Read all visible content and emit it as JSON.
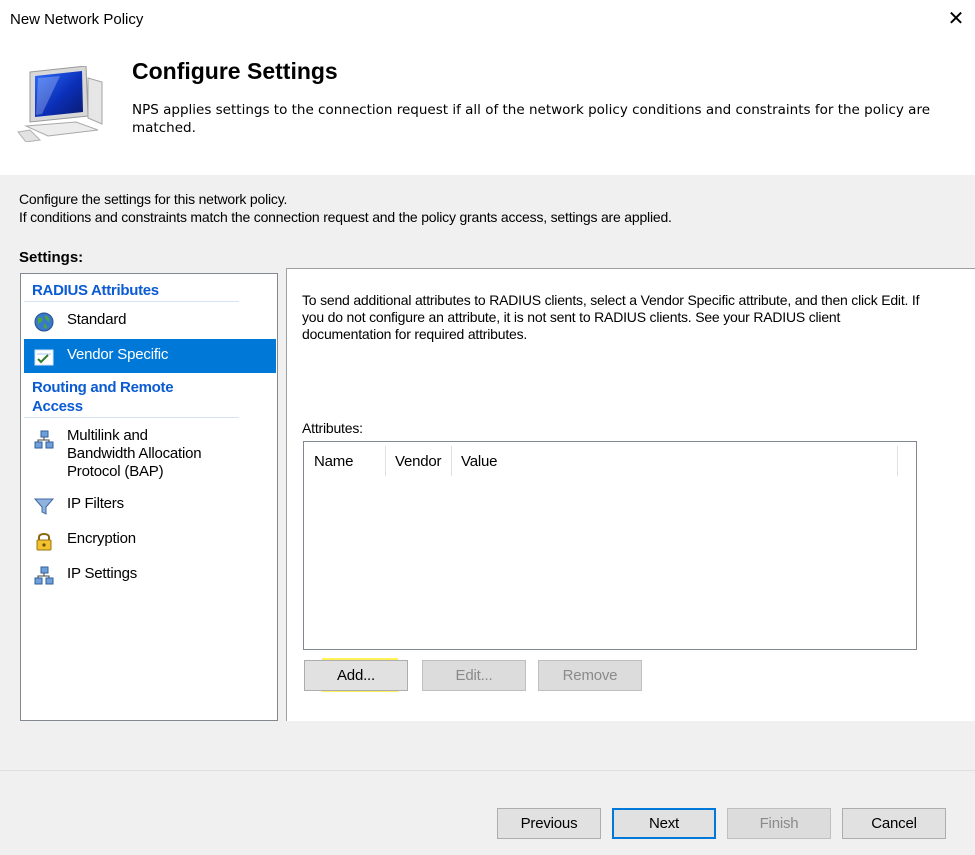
{
  "window": {
    "title": "New Network Policy",
    "close_glyph": "✕"
  },
  "header": {
    "heading": "Configure Settings",
    "subtitle_line1": "NPS applies settings to the connection request if all of the network policy conditions and constraints for the policy are",
    "subtitle_line2": "matched.",
    "icon": "monitor-icon"
  },
  "intro": {
    "line1": "Configure the settings for this network policy.",
    "line2": "If conditions and constraints match the connection request and the policy grants access, settings are applied."
  },
  "settings_label": "Settings:",
  "nav": {
    "group1": "RADIUS Attributes",
    "items1": [
      {
        "label": "Standard",
        "icon": "globe-icon",
        "selected": false
      },
      {
        "label": "Vendor Specific",
        "icon": "checklist-icon",
        "selected": true
      }
    ],
    "group2": "Routing and Remote Access",
    "group2_line1": "Routing and Remote",
    "group2_line2": "Access",
    "items2": [
      {
        "label_line1": "Multilink and",
        "label_line2": "Bandwidth Allocation",
        "label_line3": "Protocol (BAP)",
        "icon": "network-icon"
      },
      {
        "label": "IP Filters",
        "icon": "funnel-icon"
      },
      {
        "label": "Encryption",
        "icon": "lock-icon"
      },
      {
        "label": "IP Settings",
        "icon": "network-icon"
      }
    ]
  },
  "detail": {
    "description": "To send additional attributes to RADIUS clients, select a Vendor Specific attribute, and then click Edit. If you do not configure an attribute, it is not sent to RADIUS clients. See your RADIUS client documentation for required attributes.",
    "attributes_label": "Attributes:",
    "columns": [
      "Name",
      "Vendor",
      "Value"
    ],
    "rows": [],
    "add_label": "Add...",
    "edit_label": "Edit...",
    "remove_label": "Remove",
    "highlight_color": "#fff15a"
  },
  "footer": {
    "previous_label": "Previous",
    "next_label": "Next",
    "finish_label": "Finish",
    "cancel_label": "Cancel"
  },
  "colors": {
    "accent": "#0078d7",
    "group_heading": "#0b5bd3",
    "dialog_bg": "#f0f0f0"
  }
}
